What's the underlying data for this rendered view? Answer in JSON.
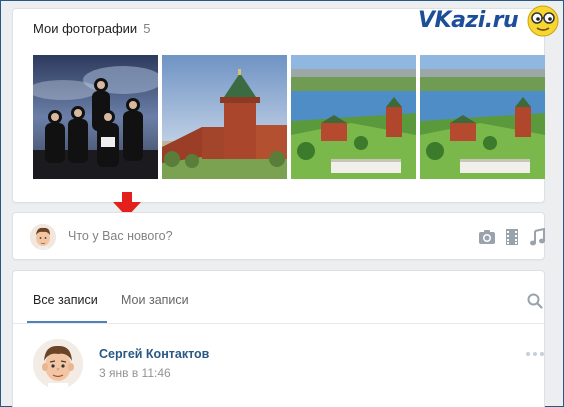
{
  "photos": {
    "title": "Мои фотографии",
    "count": "5",
    "items": [
      {
        "icon": "band-photo"
      },
      {
        "icon": "kremlin-tower-photo"
      },
      {
        "icon": "river-city-photo"
      },
      {
        "icon": "river-city-photo"
      }
    ]
  },
  "logo": {
    "text": "VKazi.ru",
    "icon": "smiley-glasses-icon"
  },
  "composer": {
    "placeholder": "Что у Вас нового?",
    "tools": [
      "camera-icon",
      "film-icon",
      "music-icon"
    ]
  },
  "feed": {
    "tabs": [
      {
        "label": "Все записи",
        "active": true
      },
      {
        "label": "Мои записи",
        "active": false
      }
    ],
    "post": {
      "author": "Сергей Контактов",
      "date": "3 янв в 11:46"
    }
  },
  "colors": {
    "accent": "#5181b8",
    "link": "#2a5885",
    "arrow": "#e3201b",
    "logo": "#1c4e9a"
  }
}
